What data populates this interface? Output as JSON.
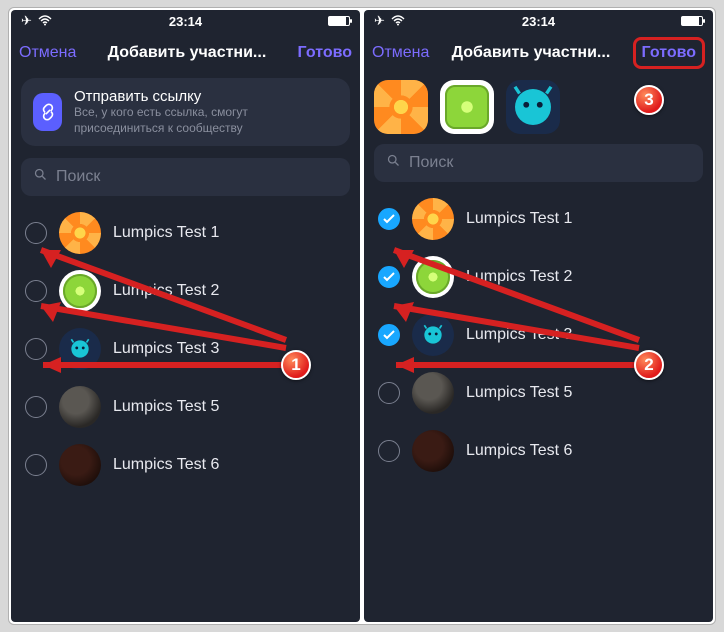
{
  "statusbar": {
    "time": "23:14"
  },
  "nav": {
    "cancel": "Отмена",
    "title": "Добавить участни...",
    "done": "Готово"
  },
  "link_card": {
    "title": "Отправить ссылку",
    "subtitle": "Все, у кого есть ссылка, смогут присоединиться к сообществу"
  },
  "search": {
    "placeholder": "Поиск"
  },
  "contacts": [
    {
      "label": "Lumpics Test 1",
      "avatar": "orange"
    },
    {
      "label": "Lumpics Test 2",
      "avatar": "lime"
    },
    {
      "label": "Lumpics Test 3",
      "avatar": "cyan"
    },
    {
      "label": "Lumpics Test 5",
      "avatar": "dark1"
    },
    {
      "label": "Lumpics Test 6",
      "avatar": "dark2"
    }
  ],
  "badges": {
    "b1": "1",
    "b2": "2",
    "b3": "3"
  },
  "left_checked": [
    false,
    false,
    false,
    false,
    false
  ],
  "right_checked": [
    true,
    true,
    true,
    false,
    false
  ]
}
